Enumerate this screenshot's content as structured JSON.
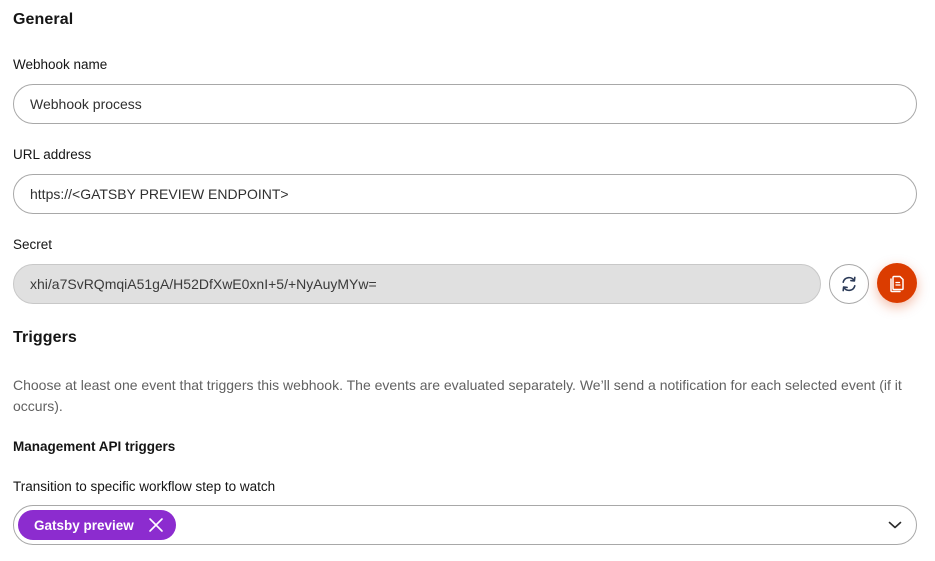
{
  "general": {
    "title": "General",
    "webhook_name": {
      "label": "Webhook name",
      "value": "Webhook process"
    },
    "url_address": {
      "label": "URL address",
      "value": "https://<GATSBY PREVIEW ENDPOINT>"
    },
    "secret": {
      "label": "Secret",
      "value": "xhi/a7SvRQmqiA51gA/H52DfXwE0xnI+5/+NyAuyMYw=",
      "regenerate_icon": "refresh-icon",
      "copy_icon": "copy-icon"
    }
  },
  "triggers": {
    "title": "Triggers",
    "description": "Choose at least one event that triggers this webhook. The events are evaluated separately. We’ll send a notification for each selected event (if it occurs).",
    "management_api": {
      "title": "Management API triggers",
      "workflow_step": {
        "label": "Transition to specific workflow step to watch",
        "selected": [
          "Gatsby preview"
        ]
      }
    }
  },
  "colors": {
    "primary": "#db3c00",
    "chip": "#8c2ccf",
    "readonly_bg": "#e0e0e0"
  }
}
